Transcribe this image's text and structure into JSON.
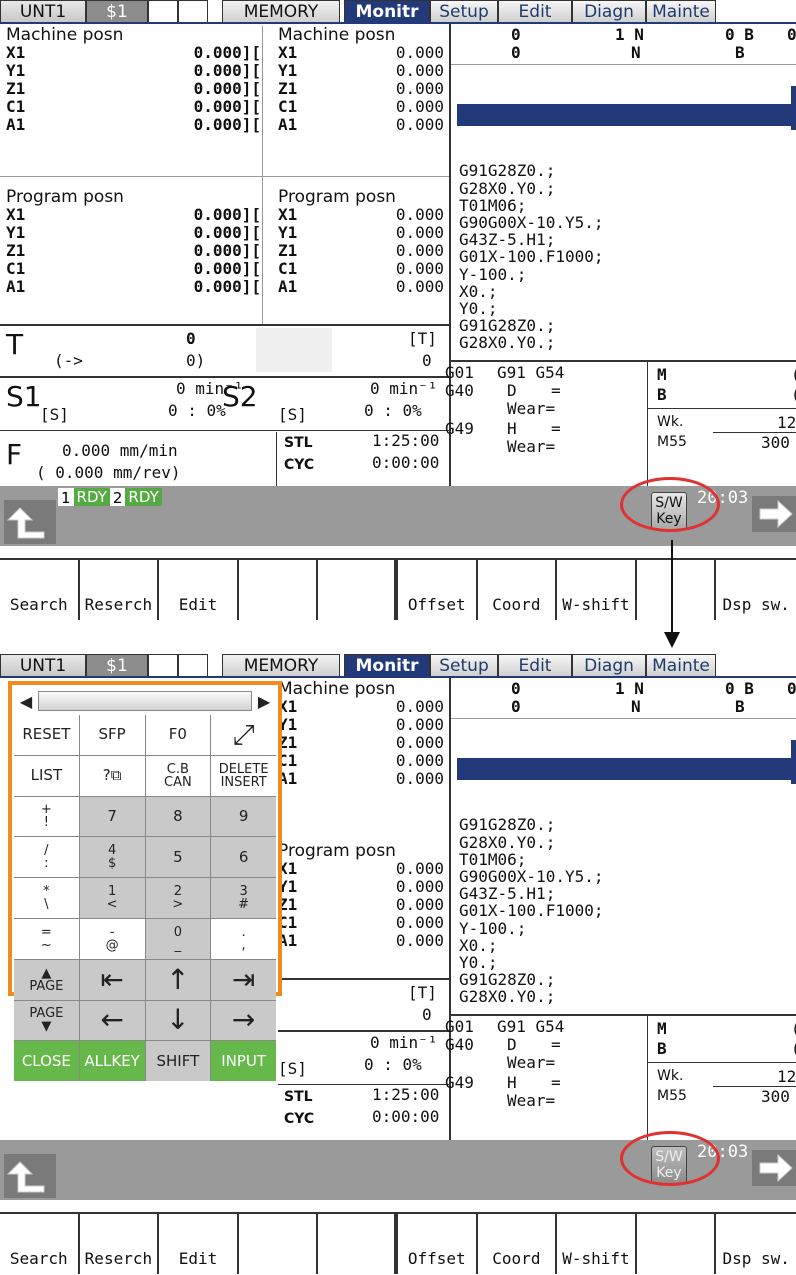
{
  "tabs": {
    "unit": "UNT1",
    "system": "$1",
    "mode": "MEMORY",
    "monitor": "Monitr",
    "setup": "Setup",
    "edit": "Edit",
    "diagn": "Diagn",
    "mainte": "Mainte"
  },
  "machine_posn": {
    "title": "Machine posn",
    "axes": [
      {
        "a": "X1",
        "v": "0.000]["
      },
      {
        "a": "Y1",
        "v": "0.000]["
      },
      {
        "a": "Z1",
        "v": "0.000]["
      },
      {
        "a": "C1",
        "v": "0.000]["
      },
      {
        "a": "A1",
        "v": "0.000]["
      }
    ]
  },
  "machine_posn2": {
    "title": "Machine posn",
    "axes": [
      {
        "a": "X1",
        "v": "0.000"
      },
      {
        "a": "Y1",
        "v": "0.000"
      },
      {
        "a": "Z1",
        "v": "0.000"
      },
      {
        "a": "C1",
        "v": "0.000"
      },
      {
        "a": "A1",
        "v": "0.000"
      }
    ]
  },
  "program_posn": {
    "title": "Program posn",
    "axes": [
      {
        "a": "X1",
        "v": "0.000]["
      },
      {
        "a": "Y1",
        "v": "0.000]["
      },
      {
        "a": "Z1",
        "v": "0.000]["
      },
      {
        "a": "C1",
        "v": "0.000]["
      },
      {
        "a": "A1",
        "v": "0.000]["
      }
    ]
  },
  "program_posn2": {
    "title": "Program posn",
    "axes": [
      {
        "a": "X1",
        "v": "0.000"
      },
      {
        "a": "Y1",
        "v": "0.000"
      },
      {
        "a": "Z1",
        "v": "0.000"
      },
      {
        "a": "C1",
        "v": "0.000"
      },
      {
        "a": "A1",
        "v": "0.000"
      }
    ]
  },
  "tool": {
    "label": "T",
    "value": "0",
    "arrow": "(->",
    "next": "0)",
    "bracket_t": "[T]",
    "bracket_v": "0"
  },
  "spindle": {
    "s1": "S1",
    "s1_unit": "0 min⁻¹",
    "s1_tag": "[S]",
    "s1_pct": "0 :  0%",
    "s2": "S2",
    "s2_tag": "[S]",
    "s2_unit": "0 min⁻¹",
    "s2_pct": "0 :  0%"
  },
  "feed": {
    "label": "F",
    "mm_min": "0.000 mm/min",
    "mm_rev": "( 0.000   mm/rev)",
    "stl": "STL",
    "stl_time": "1:25:00",
    "cyc": "CYC",
    "cyc_time": "0:00:00"
  },
  "prog_header": {
    "r1c1": "0",
    "r1c2": "1 N",
    "r1c3": "0 B",
    "r1c4": "0",
    "r2c1": "0",
    "r2c2": "N",
    "r2c3": "B"
  },
  "program_lines": [
    "G91G28Z0.;",
    "G28X0.Y0.;",
    "T01M06;",
    "G90G00X-10.Y5.;",
    "G43Z-5.H1;",
    "G01X-100.F1000;",
    "Y-100.;",
    "X0.;",
    "Y0.;",
    "G91G28Z0.;",
    "G28X0.Y0.;"
  ],
  "modal": {
    "g01": "G01",
    "g91": "G91 G54",
    "g40": "G40",
    "d": "D",
    "eq": "=",
    "wear": "Wear=",
    "g49": "G49",
    "h": "H",
    "m": "M",
    "b": "B",
    "wk": "Wk.",
    "m55": "M55",
    "c1": "(",
    "c2": "(",
    "n12": "12",
    "n300": "300"
  },
  "status": {
    "rdy1n": "1",
    "rdy1": "RDY",
    "rdy2n": "2",
    "rdy2": "RDY",
    "swkey_l1": "S/W",
    "swkey_l2": "Key",
    "clock": "20:03"
  },
  "fkeys": [
    "Search",
    "Reserch",
    "Edit",
    "",
    "",
    "Offset",
    "Coord",
    "W-shift",
    "",
    "Dsp sw."
  ],
  "keyboard": {
    "scroll_left": "◀",
    "scroll_right": "▶",
    "keys": [
      {
        "t": "RESET",
        "c": "w"
      },
      {
        "t": "SFP",
        "c": "w"
      },
      {
        "t": "F0",
        "c": "w"
      },
      {
        "t": "⤢",
        "c": "w ar",
        "n": "resize-icon"
      },
      {
        "t": "LIST",
        "c": "w"
      },
      {
        "t": "?⧉",
        "c": "w",
        "n": "help-icon"
      },
      {
        "t": "C.B\nCAN",
        "c": "w two"
      },
      {
        "t": "DELETE\nINSERT",
        "c": "w two"
      },
      {
        "t": "+\n!",
        "c": "w two"
      },
      {
        "t": "7",
        "c": "gr"
      },
      {
        "t": "8",
        "c": "gr"
      },
      {
        "t": "9",
        "c": "gr"
      },
      {
        "t": "/\n:",
        "c": "w two"
      },
      {
        "t": "4\n$",
        "c": "gr two"
      },
      {
        "t": "5",
        "c": "gr"
      },
      {
        "t": "6",
        "c": "gr"
      },
      {
        "t": "*\n\\",
        "c": "w two"
      },
      {
        "t": "1\n<",
        "c": "gr two"
      },
      {
        "t": "2\n>",
        "c": "gr two"
      },
      {
        "t": "3\n#",
        "c": "gr two"
      },
      {
        "t": "=\n~",
        "c": "w two"
      },
      {
        "t": "-\n@",
        "c": "w two"
      },
      {
        "t": "0\n_",
        "c": "gr two"
      },
      {
        "t": ".\n,",
        "c": "w two"
      },
      {
        "t": "▲\nPAGE",
        "c": "gr two"
      },
      {
        "t": "⇤",
        "c": "gr ar"
      },
      {
        "t": "↑",
        "c": "gr ar"
      },
      {
        "t": "⇥",
        "c": "gr ar"
      },
      {
        "t": "PAGE\n▼",
        "c": "gr two"
      },
      {
        "t": "←",
        "c": "gr ar"
      },
      {
        "t": "↓",
        "c": "gr ar"
      },
      {
        "t": "→",
        "c": "gr ar"
      },
      {
        "t": "CLOSE",
        "c": "gn"
      },
      {
        "t": "ALLKEY",
        "c": "gn"
      },
      {
        "t": "SHIFT",
        "c": "gr"
      },
      {
        "t": "INPUT",
        "c": "gn"
      }
    ]
  }
}
